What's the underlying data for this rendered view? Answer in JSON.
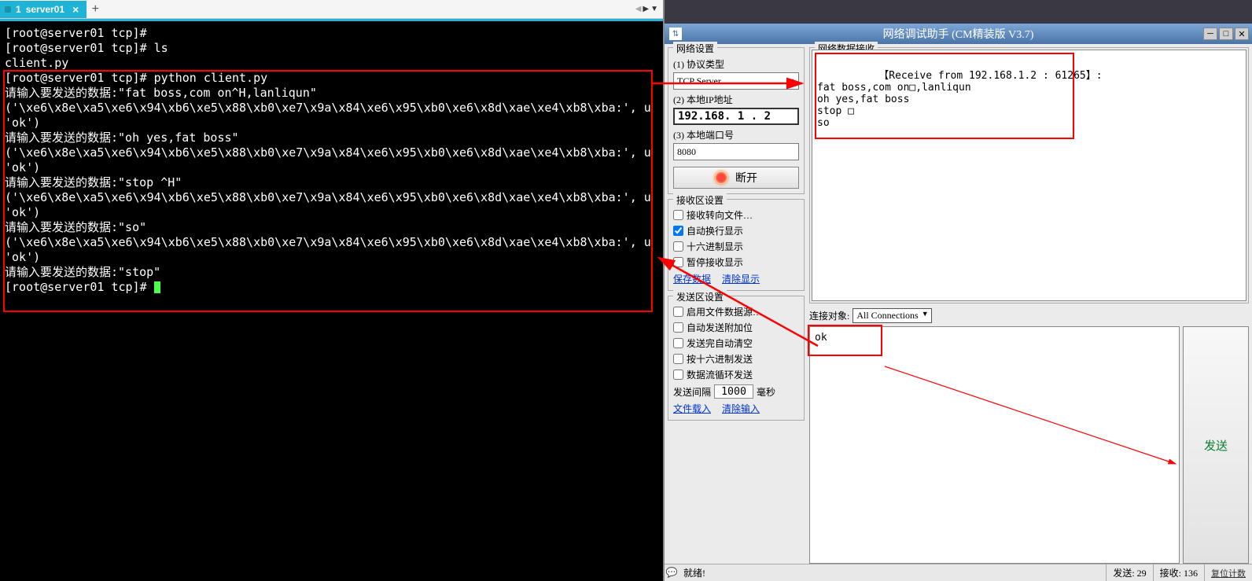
{
  "tab": {
    "index": "1",
    "name": "server01",
    "add": "+"
  },
  "terminal_lines": [
    "[root@server01 tcp]#",
    "[root@server01 tcp]# ls",
    "client.py",
    "[root@server01 tcp]# python client.py",
    "请输入要发送的数据:\"fat boss,com on^H,lanliqun\"",
    "('\\xe6\\x8e\\xa5\\xe6\\x94\\xb6\\xe5\\x88\\xb0\\xe7\\x9a\\x84\\xe6\\x95\\xb0\\xe6\\x8d\\xae\\xe4\\xb8\\xba:', u",
    "'ok')",
    "请输入要发送的数据:\"oh yes,fat boss\"",
    "('\\xe6\\x8e\\xa5\\xe6\\x94\\xb6\\xe5\\x88\\xb0\\xe7\\x9a\\x84\\xe6\\x95\\xb0\\xe6\\x8d\\xae\\xe4\\xb8\\xba:', u",
    "'ok')",
    "请输入要发送的数据:\"stop ^H\"",
    "('\\xe6\\x8e\\xa5\\xe6\\x94\\xb6\\xe5\\x88\\xb0\\xe7\\x9a\\x84\\xe6\\x95\\xb0\\xe6\\x8d\\xae\\xe4\\xb8\\xba:', u",
    "'ok')",
    "请输入要发送的数据:\"so\"",
    "('\\xe6\\x8e\\xa5\\xe6\\x94\\xb6\\xe5\\x88\\xb0\\xe7\\x9a\\x84\\xe6\\x95\\xb0\\xe6\\x8d\\xae\\xe4\\xb8\\xba:', u",
    "'ok')",
    "请输入要发送的数据:\"stop\"",
    "[root@server01 tcp]# "
  ],
  "app": {
    "title": "网络调试助手 (CM精装版 V3.7)",
    "groups": {
      "net": "网络设置",
      "recv_cfg": "接收区设置",
      "send_cfg": "发送区设置",
      "recv_data": "网络数据接收"
    },
    "net": {
      "proto_label": "(1) 协议类型",
      "proto_value": "TCP Server",
      "ip_label": "(2) 本地IP地址",
      "ip_value": "192.168. 1 . 2",
      "port_label": "(3) 本地端口号",
      "port_value": "8080",
      "disconnect": "断开"
    },
    "recv_cfg": {
      "c1": "接收转向文件…",
      "c2": "自动换行显示",
      "c3": "十六进制显示",
      "c4": "暂停接收显示",
      "save": "保存数据",
      "clear": "清除显示"
    },
    "send_cfg": {
      "c1": "启用文件数据源…",
      "c2": "自动发送附加位",
      "c3": "发送完自动清空",
      "c4": "按十六进制发送",
      "c5": "数据流循环发送",
      "interval_lbl": "发送间隔",
      "interval_val": "1000",
      "interval_unit": "毫秒",
      "load": "文件载入",
      "clear": "清除输入"
    },
    "conn_target_label": "连接对象:",
    "conn_target_value": "All Connections",
    "recv_text": "【Receive from 192.168.1.2 : 61265】:\nfat boss,com on□,lanliqun\noh yes,fat boss\nstop □\nso",
    "send_text": "ok",
    "send_btn": "发送",
    "status": {
      "ready": "就绪!",
      "sent": "发送: 29",
      "recv": "接收: 136",
      "reset": "复位计数"
    }
  },
  "checks": {
    "recv2": true
  }
}
